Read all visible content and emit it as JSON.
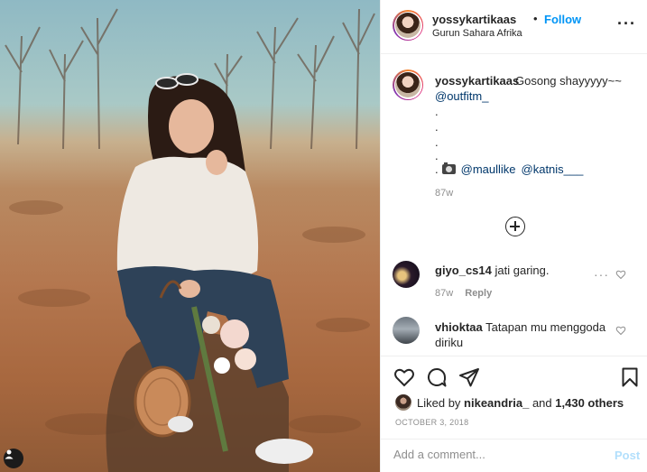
{
  "photo": {
    "description_icon": "user-silhouette-icon"
  },
  "header": {
    "username": "yossykartikaas",
    "separator": "•",
    "follow_label": "Follow",
    "location": "Gurun Sahara Afrika",
    "more_icon": "more-horizontal-icon",
    "more_label": "···"
  },
  "caption": {
    "username": "yossykartikaas",
    "text": "Gosong shayyyyy~~",
    "mention": "@outfitm_",
    "dots": [
      ".",
      ".",
      ".",
      "."
    ],
    "credits_prefix": ".",
    "credits_icon": "camera-icon",
    "credit_1": "@maullike",
    "credit_2": "@katnis___",
    "time": "87w"
  },
  "load_more_icon": "plus-circle-icon",
  "comments": [
    {
      "username": "giyo_cs14",
      "text": "jati garing.",
      "time": "87w",
      "reply_label": "Reply",
      "more_label": "···"
    },
    {
      "username": "vhioktaa",
      "text": "Tatapan mu menggoda diriku",
      "more_label": ""
    }
  ],
  "actions": {
    "like_icon": "heart-icon",
    "comment_icon": "comment-icon",
    "share_icon": "paper-plane-icon",
    "save_icon": "bookmark-icon"
  },
  "likes": {
    "prefix": "Liked by",
    "user": "nikeandria_",
    "middle": "and",
    "count": "1,430 others"
  },
  "date": "OCTOBER 3, 2018",
  "add_comment": {
    "placeholder": "Add a comment...",
    "post_label": "Post"
  },
  "colors": {
    "accent": "#0095f6",
    "link": "#00376b",
    "muted": "#8e8e8e",
    "border": "#efefef"
  }
}
